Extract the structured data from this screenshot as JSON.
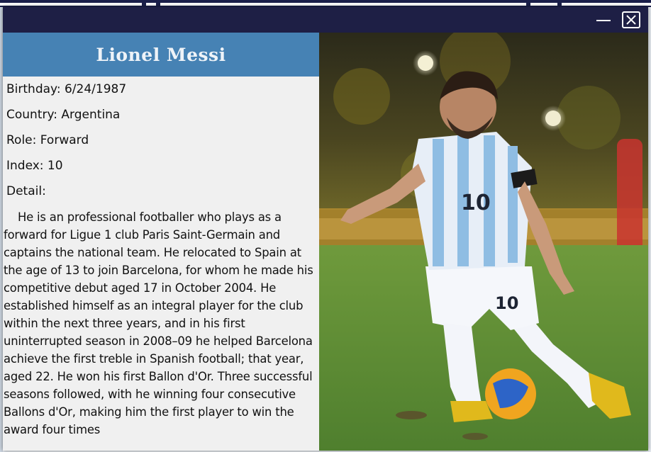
{
  "window": {
    "minimize_icon": "minimize-icon",
    "close_icon": "close-icon"
  },
  "player": {
    "name": "Lionel Messi",
    "birthday": "Birthday: 6/24/1987",
    "country": "Country: Argentina",
    "role": "Role: Forward",
    "index": "Index: 10",
    "detail_label": "Detail:",
    "detail": "He is an professional footballer who plays as a forward for Ligue 1 club Paris Saint-Germain and captains the national team. He relocated to Spain at the age of 13 to join Barcelona, for whom he made his competitive debut aged 17 in October 2004. He established himself as an integral player for the club within the next three years, and in his first uninterrupted season in 2008–09 he helped Barcelona achieve the first treble in Spanish football; that year, aged 22. He won his first Ballon d'Or. Three successful seasons followed, with he winning four consecutive Ballons d'Or, making him the first player to win the award four times",
    "shirt_number": "10"
  },
  "colors": {
    "header_bg": "#4682b4",
    "titlebar_bg": "#1e1f45",
    "panel_bg": "#f0f0f0",
    "pitch_green": "#5f8f3a"
  }
}
